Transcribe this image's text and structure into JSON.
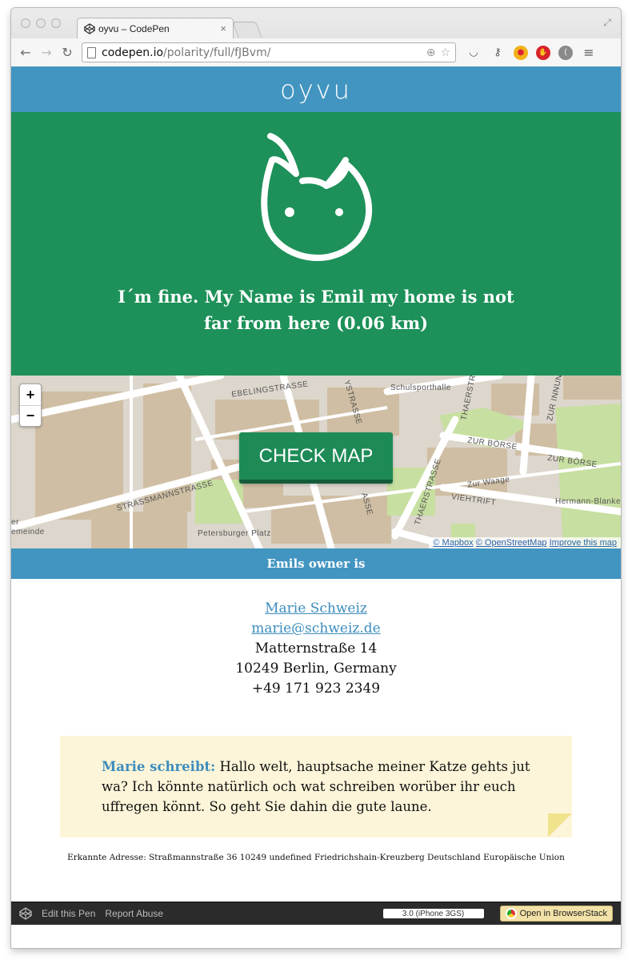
{
  "browser": {
    "tab_title": "oyvu – CodePen",
    "tab_close": "×",
    "url_host": "codepen.io",
    "url_path": "/polarity/full/fJBvm/"
  },
  "site": {
    "brand": "oyvu",
    "hero_message": "I´m fine. My Name is Emil my home is not far from here (0.06 km)",
    "colors": {
      "blue": "#4295c1",
      "green": "#1d9159",
      "note": "#fdf5d9"
    }
  },
  "map": {
    "zoom_in": "+",
    "zoom_out": "−",
    "button": "CHECK MAP",
    "attribution_mapbox": "© Mapbox",
    "attribution_osm": "© OpenStreetMap",
    "attribution_improve": "Improve this map",
    "labels": {
      "ebelingstrasse": "EBELINGSTRASSE",
      "schulsporthalle": "Schulsporthalle",
      "thaerstrasse_top": "THAERSTR",
      "zur_innung": "ZUR INNUN",
      "zur_boerse_1": "ZUR BÖRSE",
      "zur_boerse_2": "ZUR BÖRSE",
      "zur_waage": "Zur Waage",
      "viehtrift": "VIEHTRIFT",
      "thaerstrasse": "THAERSTRASSE",
      "hermann": "Hermann-Blanke",
      "strassmannstrasse": "STRASSMANNSTRASSE",
      "petersburger": "Petersburger Platz",
      "gemeinde": "emeinde",
      "er": "er",
      "ystrasse": "YSTRASSE",
      "asse": "ASSE"
    }
  },
  "owner": {
    "heading": "Emils owner is",
    "name": "Marie Schweiz",
    "email": "marie@schweiz.de",
    "street": "Matternstraße 14",
    "city": "10249 Berlin, Germany",
    "phone": "+49 171 923 2349"
  },
  "note": {
    "author": "Marie schreibt:",
    "text": "Hallo welt, hauptsache meiner Katze gehts jut wa? Ich könnte natürlich och wat schreiben worüber ihr euch uffregen könnt. So geht Sie dahin die gute laune."
  },
  "detected_address": "Erkannte Adresse: Straßmannstraße 36 10249 undefined Friedrichshain-Kreuzberg Deutschland Europäische Union",
  "footer": {
    "edit": "Edit this Pen",
    "report": "Report Abuse",
    "device": "3.0 (iPhone 3GS)",
    "browserstack": "Open in BrowserStack"
  }
}
